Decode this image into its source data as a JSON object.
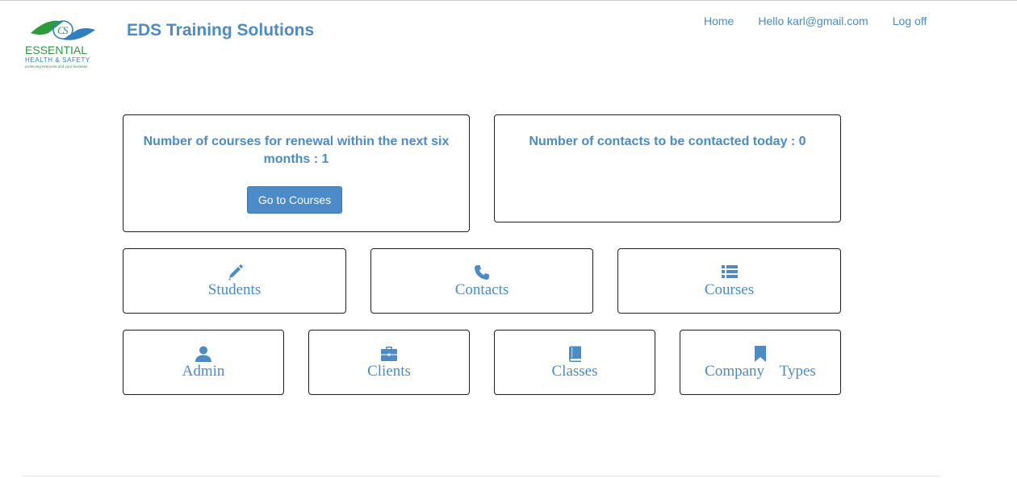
{
  "logo": {
    "line1": "ESSENTIAL",
    "line2": "HEALTH & SAFETY",
    "tagline": "protecting everyone and your business",
    "colors": {
      "green": "#2e9a3e",
      "blue": "#2f7fc1"
    }
  },
  "header": {
    "brand": "EDS Training Solutions",
    "nav": {
      "home": "Home",
      "hello": "Hello karl@gmail.com",
      "logoff": "Log off"
    }
  },
  "stats": {
    "renewal": {
      "text": "Number of courses for renewal within the next six months : 1",
      "button": "Go to Courses"
    },
    "contacts_today": {
      "text": "Number of contacts to be contacted today : 0"
    }
  },
  "tiles": {
    "students": {
      "label": "Students",
      "icon": "pencil-icon"
    },
    "contacts": {
      "label": "Contacts",
      "icon": "phone-icon"
    },
    "courses": {
      "label": "Courses",
      "icon": "list-icon"
    },
    "admin": {
      "label": "Admin",
      "icon": "user-icon"
    },
    "clients": {
      "label": "Clients",
      "icon": "briefcase-icon"
    },
    "classes": {
      "label": "Classes",
      "icon": "book-icon"
    },
    "company_types": {
      "label": "Company    Types",
      "icon": "bookmark-icon"
    }
  },
  "colors": {
    "accent": "#4a8bc8",
    "border": "#1f1f1f"
  }
}
